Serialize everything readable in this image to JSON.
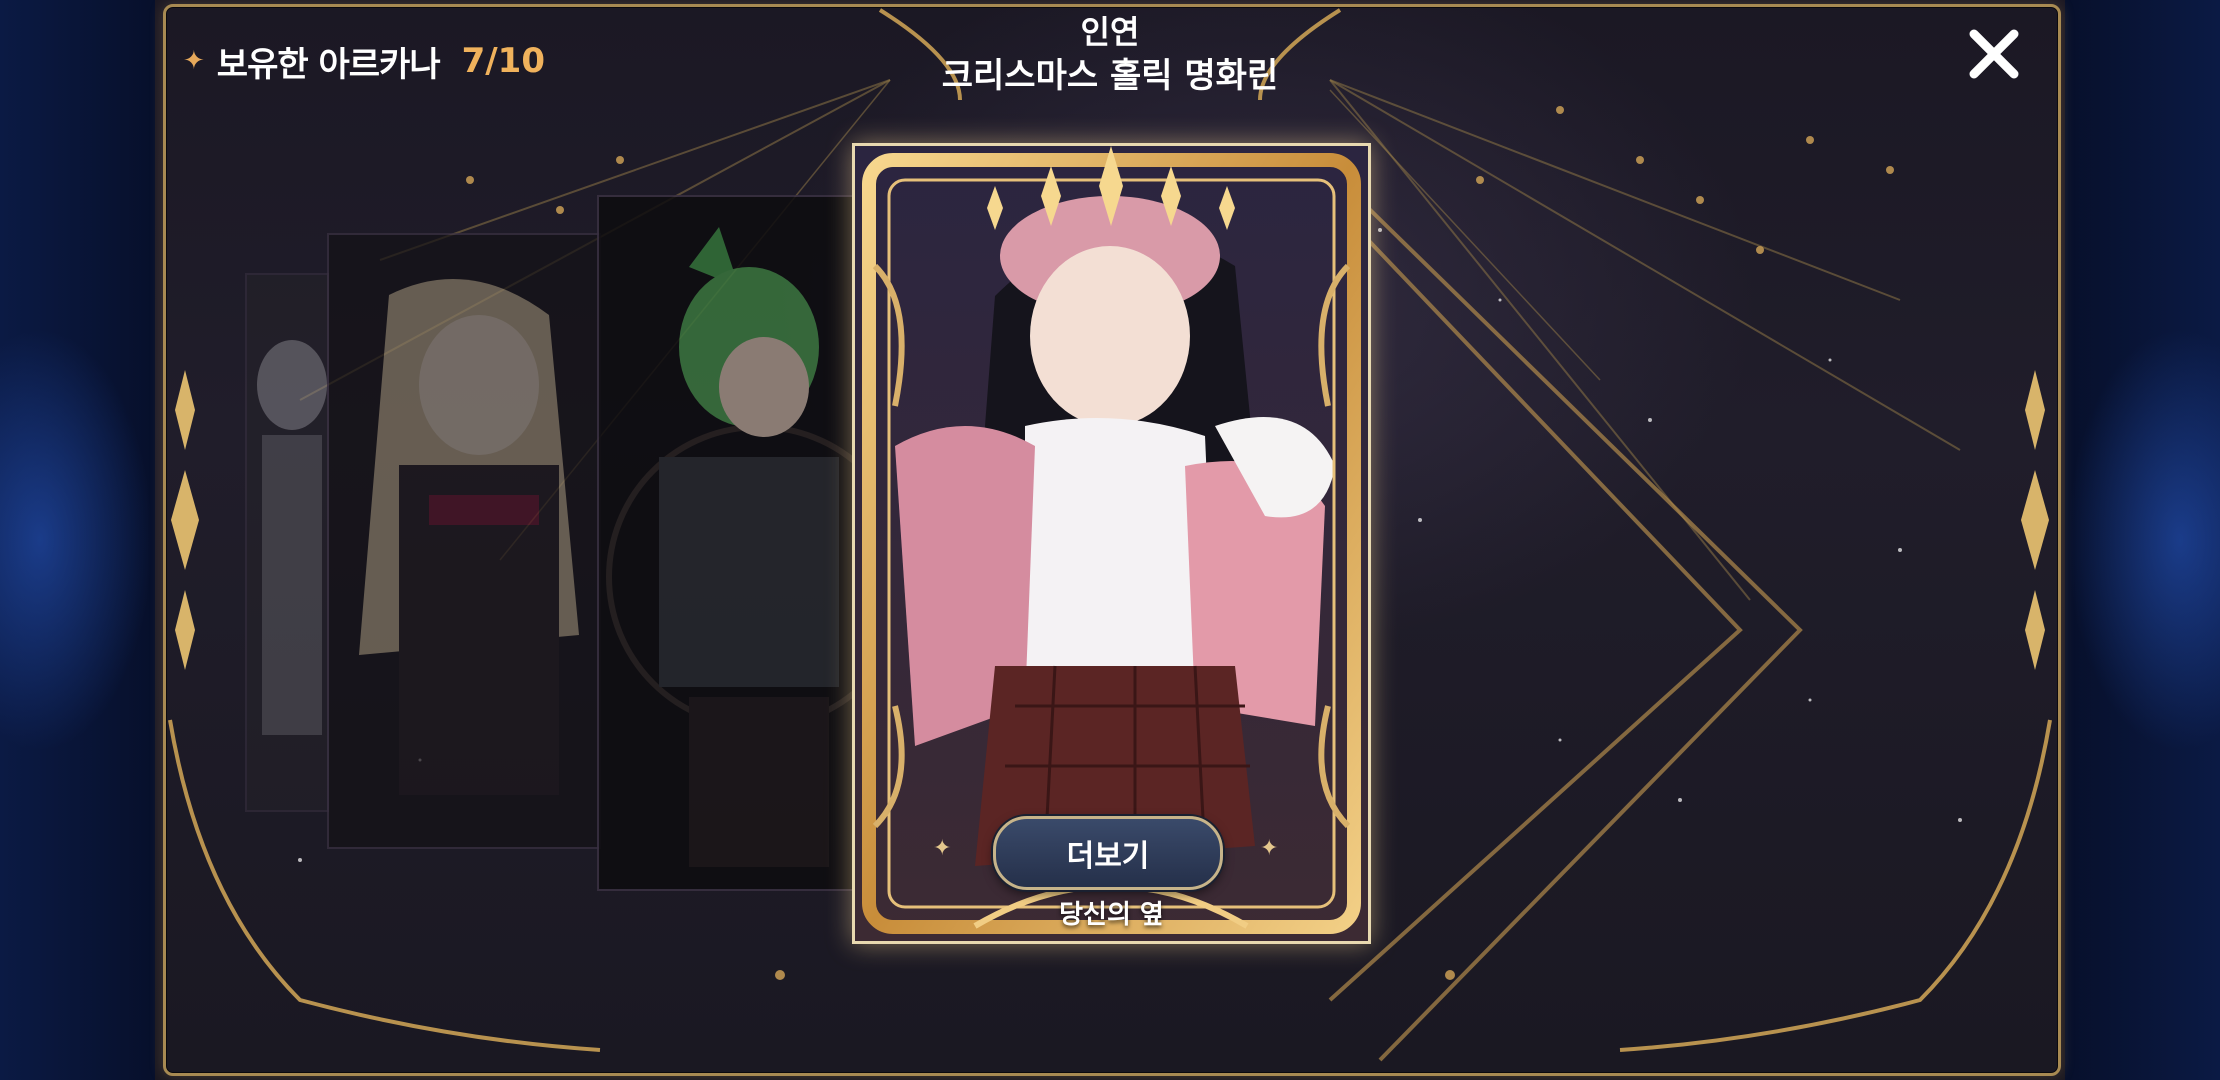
{
  "header": {
    "owned_label": "보유한 아르카나",
    "owned_count": "7/10"
  },
  "title": {
    "subtitle": "인연",
    "name": "크리스마스 홀릭 명화린"
  },
  "close_icon": "close-icon",
  "featured_card": {
    "caption": "당신의 옆",
    "more_button": "더보기"
  },
  "colors": {
    "accent_gold": "#f0b25c",
    "frame_gold": "#d6ac5e",
    "panel_bg": "#1f1c28",
    "side_bg": "#07102c"
  }
}
